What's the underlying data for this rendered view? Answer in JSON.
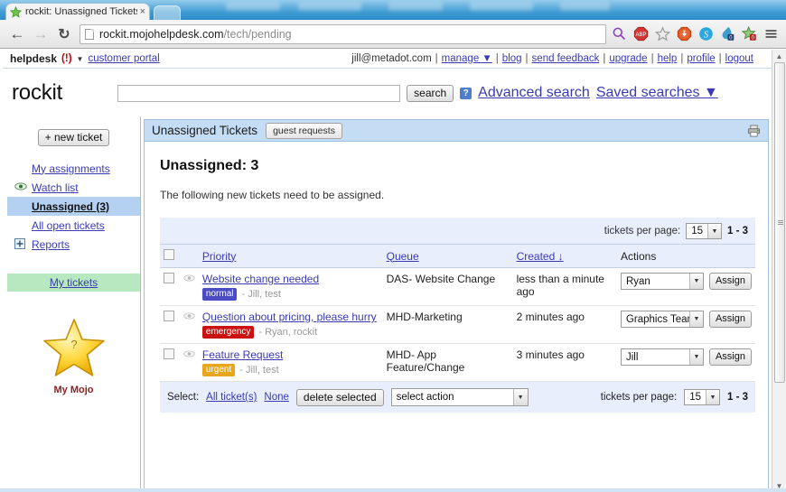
{
  "browser": {
    "tab": {
      "title": "rockit: Unassigned Tickets",
      "close_label": "×",
      "favicon": "star-favicon"
    },
    "new_tab_label": "",
    "nav": {
      "back": "←",
      "forward": "→",
      "reload": "↻"
    },
    "url": {
      "domain": "rockit.mojohelpdesk.com",
      "path": "/tech/pending"
    },
    "extensions": [
      "zoom-icon",
      "adblock-icon",
      "bookmark-star-icon",
      "downloader-icon",
      "skype-icon",
      "droplet-icon",
      "star-badge-icon",
      "menu-icon"
    ],
    "badges": {
      "droplet": "0",
      "star": "0"
    }
  },
  "topbar": {
    "helpdesk_label": "helpdesk",
    "alert": "(!)",
    "caret": "▼",
    "customer_portal": "customer portal",
    "user_email": "jill@metadot.com",
    "links": [
      "manage ▼",
      "blog",
      "send feedback",
      "upgrade",
      "help",
      "profile",
      "logout"
    ],
    "separator": "|"
  },
  "brand": {
    "name": "rockit"
  },
  "search": {
    "value": "",
    "placeholder": "",
    "button_label": "search",
    "help_label": "?",
    "advanced_label": "Advanced search",
    "saved_label": "Saved searches ▼"
  },
  "sidebar": {
    "new_ticket_label": "+ new ticket",
    "items": [
      {
        "label": "My assignments",
        "icon": "",
        "active": false
      },
      {
        "label": "Watch list",
        "icon": "eye-icon",
        "active": false
      },
      {
        "label": "Unassigned (3)",
        "icon": "",
        "active": true
      },
      {
        "label": "All open tickets",
        "icon": "",
        "active": false
      },
      {
        "label": "Reports",
        "icon": "plus-box-icon",
        "active": false
      }
    ],
    "my_tickets_label": "My tickets",
    "mojo": {
      "caption": "My Mojo",
      "mark": "?"
    }
  },
  "panel": {
    "title": "Unassigned Tickets",
    "guest_requests_label": "guest requests",
    "printer_icon": "printer-icon",
    "heading": "Unassigned: 3",
    "subtext": "The following new tickets need to be assigned."
  },
  "table": {
    "tickets_per_page_label": "tickets per page:",
    "per_page_value": "15",
    "range_label": "1 - 3",
    "columns": [
      "",
      "",
      "Priority",
      "Queue",
      "Created ↓",
      "Actions"
    ],
    "column_priority": "Priority",
    "column_queue": "Queue",
    "column_created": "Created ↓",
    "column_actions": "Actions",
    "rows": [
      {
        "title": "Website change needed",
        "priority": "normal",
        "priority_color": "#4b4bc4",
        "submitter": "- Jill, test",
        "queue": "DAS- Website Change",
        "created": "less than a minute ago",
        "assignee": "Ryan",
        "assign_label": "Assign"
      },
      {
        "title": "Question about pricing, please hurry",
        "priority": "emergency",
        "priority_color": "#cc1111",
        "submitter": "- Ryan, rockit",
        "queue": "MHD-Marketing",
        "created": "2 minutes ago",
        "assignee": "Graphics Team",
        "assign_label": "Assign"
      },
      {
        "title": "Feature Request",
        "priority": "urgent",
        "priority_color": "#e8a61d",
        "submitter": "- Jill, test",
        "queue": "MHD- App Feature/Change",
        "created": "3 minutes ago",
        "assignee": "Jill",
        "assign_label": "Assign"
      }
    ]
  },
  "footer": {
    "select_label": "Select:",
    "all_label": "All ticket(s)",
    "comma": ",",
    "none_label": "None",
    "delete_label": "delete selected",
    "action_value": "select action",
    "tickets_per_page_label": "tickets per page:",
    "per_page_value": "15",
    "range_label": "1 - 3"
  },
  "colors": {
    "accent_blue": "#c5dcf5",
    "link": "#3a3ab5",
    "active_row": "#b5d1f2",
    "my_tickets_green": "#b8e8bf",
    "table_header_bg": "#e8eefb"
  }
}
